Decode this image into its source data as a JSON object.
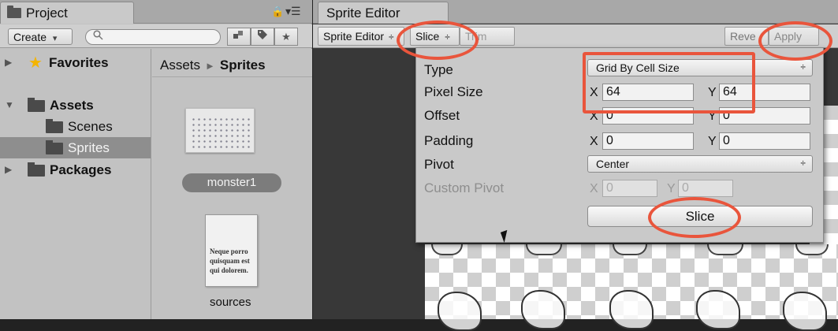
{
  "project_panel": {
    "tab_title": "Project",
    "create_label": "Create",
    "create_arrow": "▾",
    "search_icon": "🔍",
    "lock_icon": "🔒",
    "menu_icon": "▾☰",
    "filter_buttons": [
      "label-icon",
      "tag-icon",
      "star-icon"
    ],
    "tree": {
      "favorites": "Favorites",
      "assets": "Assets",
      "scenes": "Scenes",
      "sprites": "Sprites",
      "packages": "Packages"
    },
    "breadcrumb": {
      "root": "Assets",
      "separator": "►",
      "current": "Sprites"
    },
    "files": [
      {
        "name": "monster1",
        "icon": "sprite-sheet-thumbnail"
      },
      {
        "name": "sources",
        "icon": "document-icon",
        "preview_text": "Neque porro quisquam est qui dolorem."
      }
    ]
  },
  "sprite_editor": {
    "tab_title": "Sprite Editor",
    "toolbar": {
      "mode_label": "Sprite Editor",
      "mode_arrows": "÷",
      "slice_label": "Slice",
      "slice_arrows": "÷",
      "trim_label": "Trim",
      "revert_label": "Reve",
      "apply_label": "Apply"
    },
    "slice_popup": {
      "type_label": "Type",
      "type_value": "Grid By Cell Size",
      "type_arrows": "÷",
      "pixel_size_label": "Pixel Size",
      "pixel_size": {
        "x_label": "X",
        "x": "64",
        "y_label": "Y",
        "y": "64"
      },
      "offset_label": "Offset",
      "offset": {
        "x_label": "X",
        "x": "0",
        "y_label": "Y",
        "y": "0"
      },
      "padding_label": "Padding",
      "padding": {
        "x_label": "X",
        "x": "0",
        "y_label": "Y",
        "y": "0"
      },
      "pivot_label": "Pivot",
      "pivot_value": "Center",
      "pivot_arrows": "÷",
      "custom_pivot_label": "Custom Pivot",
      "custom_pivot": {
        "x_label": "X",
        "x": "0",
        "y_label": "Y",
        "y": "0"
      },
      "slice_button": "Slice"
    }
  },
  "colors": {
    "annotation": "#e9553c",
    "panel_bg": "#c2c2c2",
    "selected_row": "#8e8e8e",
    "canvas_bg": "#383838",
    "favorites_star": "#f4b400"
  }
}
